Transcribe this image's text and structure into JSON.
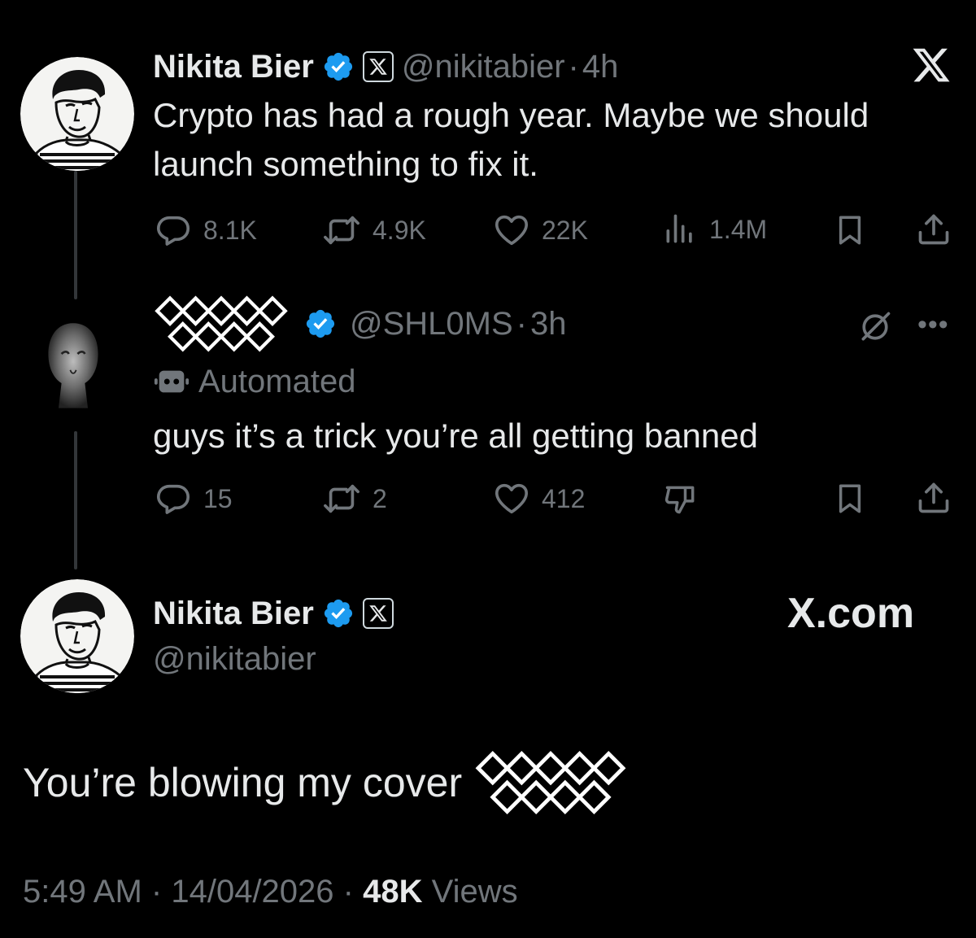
{
  "tweet1": {
    "name": "Nikita Bier",
    "handle": "@nikitabier",
    "sep": "·",
    "time": "4h",
    "text_line1": "Crypto has had a rough year. Maybe we should",
    "text_line2": "launch something to fix it.",
    "replies": "8.1K",
    "reposts": "4.9K",
    "likes": "22K",
    "views": "1.4M"
  },
  "tweet2": {
    "handle": "@SHL0MS",
    "sep": "·",
    "time": "3h",
    "automated_label": "Automated",
    "text": "guys it’s a trick you’re all getting banned",
    "replies": "15",
    "reposts": "2",
    "likes": "412"
  },
  "main_tweet": {
    "name": "Nikita Bier",
    "handle": "@nikitabier",
    "watermark": "X.com",
    "text": "You’re blowing my cover",
    "footer_time": "5:49 AM",
    "footer_sep1": "·",
    "footer_date": "14/04/2026",
    "footer_sep2": "·",
    "footer_views_count": "48K",
    "footer_views_label": "Views"
  },
  "colors": {
    "background": "#000000",
    "text": "#e7e9ea",
    "muted": "#71767b",
    "verified": "#1d9bf0",
    "thread_line": "#333639"
  },
  "icons": [
    "x-logo-icon",
    "verified-badge-icon",
    "x-affiliate-icon",
    "reply-icon",
    "repost-icon",
    "like-icon",
    "views-icon",
    "bookmark-icon",
    "share-icon",
    "grok-icon",
    "more-icon",
    "robot-icon",
    "dislike-icon",
    "lattice-glyph-icon"
  ]
}
